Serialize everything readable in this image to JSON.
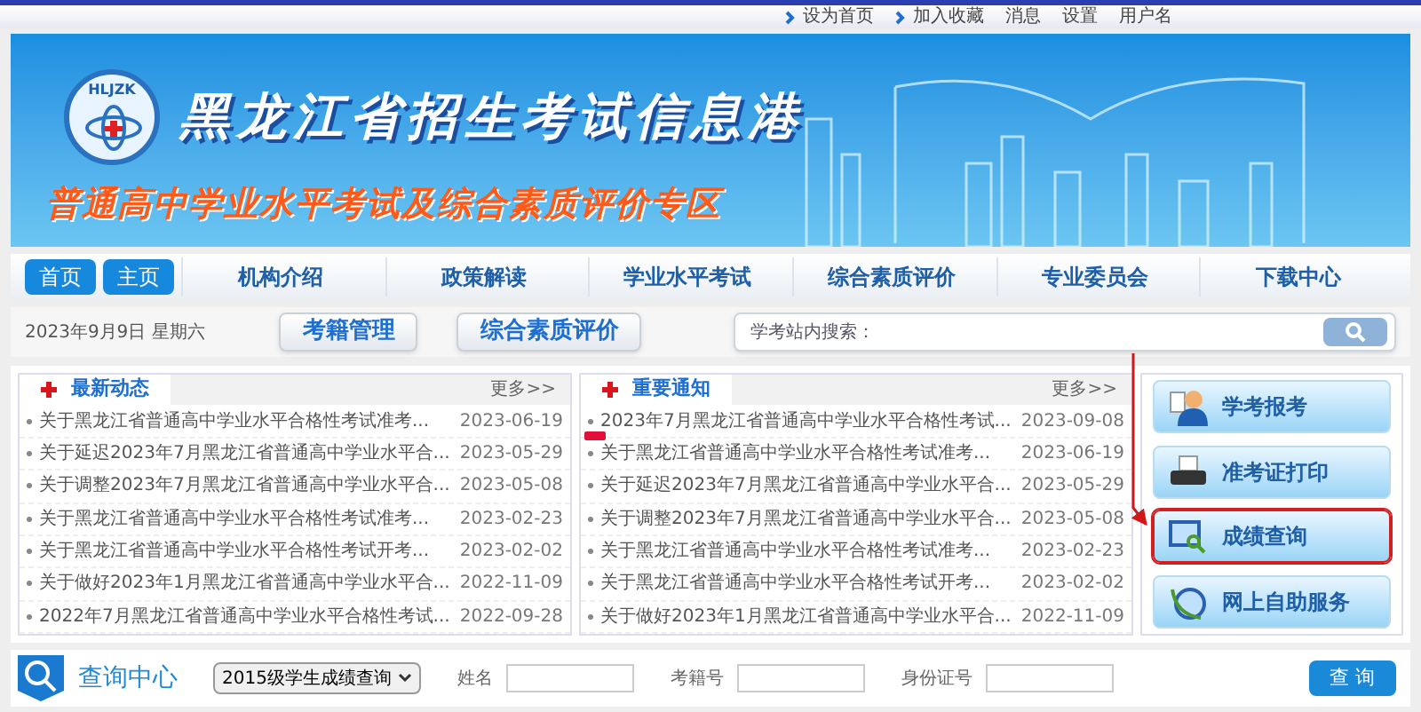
{
  "top_links": [
    {
      "label": "设为首页",
      "arrow": true
    },
    {
      "label": "加入收藏",
      "arrow": true
    },
    {
      "label": "消息",
      "arrow": false
    },
    {
      "label": "设置",
      "arrow": false
    },
    {
      "label": "用户名",
      "arrow": false
    }
  ],
  "banner": {
    "logo_text": "HLJZK",
    "title": "黑龙江省招生考试信息港",
    "subtitle": "普通高中学业水平考试及综合素质评价专区"
  },
  "nav": [
    {
      "label": "首页",
      "kind": "home"
    },
    {
      "label": "主页",
      "kind": "home"
    },
    {
      "label": "机构介绍",
      "kind": "link"
    },
    {
      "label": "政策解读",
      "kind": "link"
    },
    {
      "label": "学业水平考试",
      "kind": "link"
    },
    {
      "label": "综合素质评价",
      "kind": "link"
    },
    {
      "label": "专业委员会",
      "kind": "link"
    },
    {
      "label": "下载中心",
      "kind": "link"
    }
  ],
  "toolbar": {
    "date": "2023年9月9日",
    "weekday": "星期六",
    "buttons": [
      "考籍管理",
      "综合素质评价"
    ],
    "search_label": "学考站内搜索："
  },
  "panels": [
    {
      "title": "最新动态",
      "more": "更多>>",
      "items": [
        {
          "text": "关于黑龙江省普通高中学业水平合格性考试准考...",
          "date": "2023-06-19",
          "new": false
        },
        {
          "text": "关于延迟2023年7月黑龙江省普通高中学业水平合...",
          "date": "2023-05-29",
          "new": false
        },
        {
          "text": "关于调整2023年7月黑龙江省普通高中学业水平合...",
          "date": "2023-05-08",
          "new": false
        },
        {
          "text": "关于黑龙江省普通高中学业水平合格性考试准考...",
          "date": "2023-02-23",
          "new": false
        },
        {
          "text": "关于黑龙江省普通高中学业水平合格性考试开考...",
          "date": "2023-02-02",
          "new": false
        },
        {
          "text": "关于做好2023年1月黑龙江省普通高中学业水平合...",
          "date": "2022-11-09",
          "new": false
        },
        {
          "text": "2022年7月黑龙江省普通高中学业水平合格性考试...",
          "date": "2022-09-28",
          "new": false
        }
      ]
    },
    {
      "title": "重要通知",
      "more": "更多>>",
      "items": [
        {
          "text": "2023年7月黑龙江省普通高中学业水平合格性考试...",
          "date": "2023-09-08",
          "new": true
        },
        {
          "text": "关于黑龙江省普通高中学业水平合格性考试准考...",
          "date": "2023-06-19",
          "new": false
        },
        {
          "text": "关于延迟2023年7月黑龙江省普通高中学业水平合...",
          "date": "2023-05-29",
          "new": false
        },
        {
          "text": "关于调整2023年7月黑龙江省普通高中学业水平合...",
          "date": "2023-05-08",
          "new": false
        },
        {
          "text": "关于黑龙江省普通高中学业水平合格性考试准考...",
          "date": "2023-02-23",
          "new": false
        },
        {
          "text": "关于黑龙江省普通高中学业水平合格性考试开考...",
          "date": "2023-02-02",
          "new": false
        },
        {
          "text": "关于做好2023年1月黑龙江省普通高中学业水平合...",
          "date": "2022-11-09",
          "new": false
        }
      ]
    }
  ],
  "services": [
    {
      "label": "学考报考",
      "kind": "person",
      "highlighted": false
    },
    {
      "label": "准考证打印",
      "kind": "printer",
      "highlighted": false
    },
    {
      "label": "成绩查询",
      "kind": "window",
      "highlighted": true
    },
    {
      "label": "网上自助服务",
      "kind": "globe",
      "highlighted": false
    }
  ],
  "query": {
    "title": "查询中心",
    "select": "2015级学生成绩查询",
    "fields": [
      "姓名",
      "考籍号",
      "身份证号"
    ],
    "button": "查 询"
  },
  "annotation": {
    "arrow": true
  }
}
